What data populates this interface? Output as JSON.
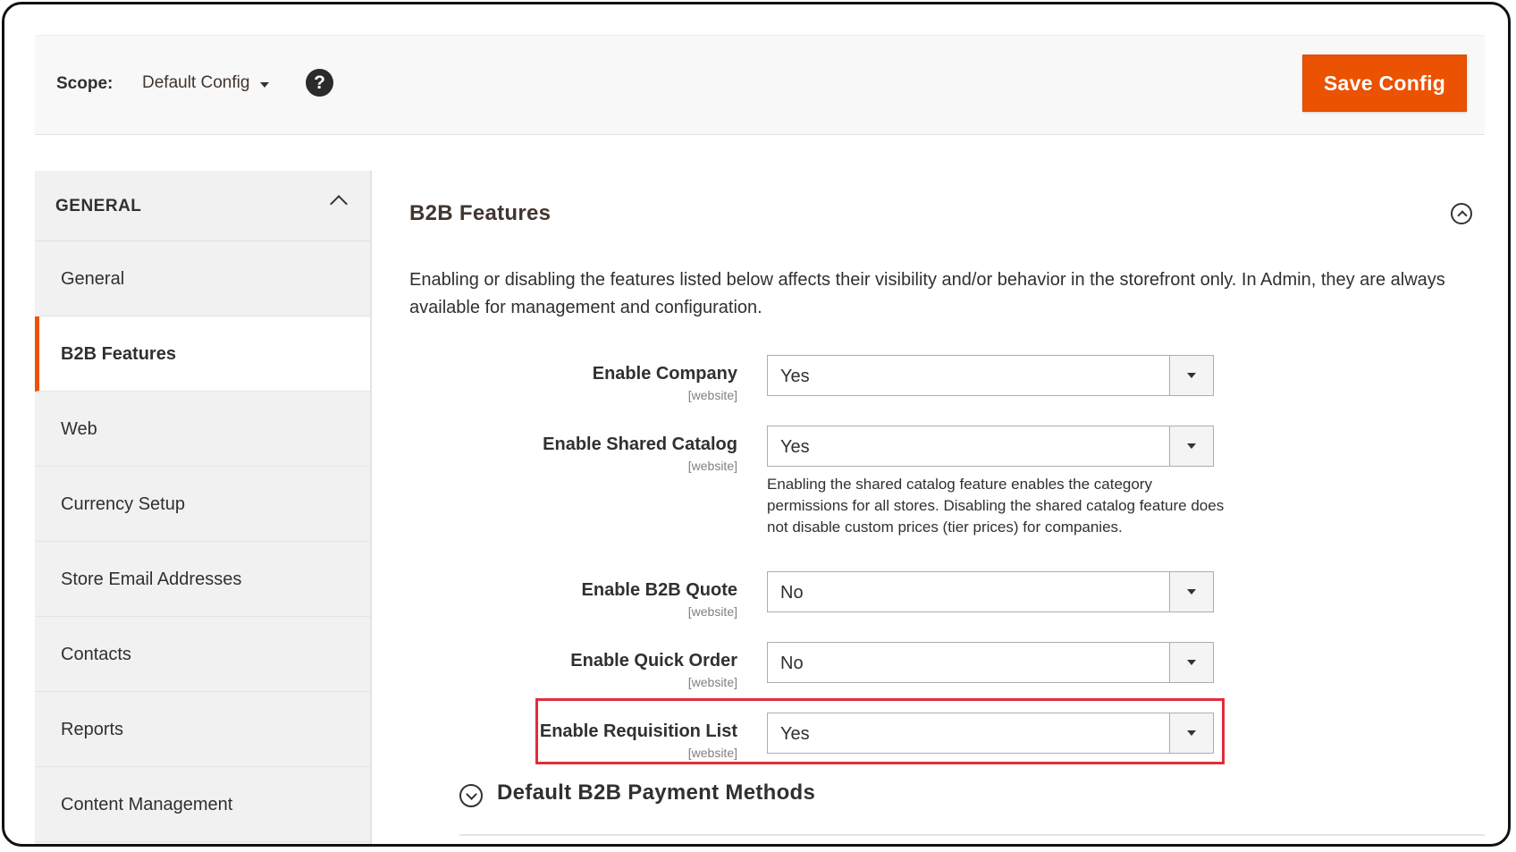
{
  "header": {
    "scope_label": "Scope:",
    "scope_value": "Default Config",
    "help_icon": "?",
    "save_label": "Save Config"
  },
  "sidebar": {
    "title": "GENERAL",
    "items": [
      {
        "label": "General",
        "active": false
      },
      {
        "label": "B2B Features",
        "active": true
      },
      {
        "label": "Web",
        "active": false
      },
      {
        "label": "Currency Setup",
        "active": false
      },
      {
        "label": "Store Email Addresses",
        "active": false
      },
      {
        "label": "Contacts",
        "active": false
      },
      {
        "label": "Reports",
        "active": false
      },
      {
        "label": "Content Management",
        "active": false
      }
    ]
  },
  "main": {
    "section_title": "B2B Features",
    "description": "Enabling or disabling the features listed below affects their visibility and/or behavior in the storefront only. In Admin, they are always available for management and configuration.",
    "fields": [
      {
        "label": "Enable Company",
        "scope": "[website]",
        "value": "Yes"
      },
      {
        "label": "Enable Shared Catalog",
        "scope": "[website]",
        "value": "Yes"
      },
      {
        "label": "Enable B2B Quote",
        "scope": "[website]",
        "value": "No"
      },
      {
        "label": "Enable Quick Order",
        "scope": "[website]",
        "value": "No"
      },
      {
        "label": "Enable Requisition List",
        "scope": "[website]",
        "value": "Yes"
      }
    ],
    "shared_catalog_hint": "Enabling the shared catalog feature enables the category permissions for all stores. Disabling the shared catalog feature does not disable custom prices (tier prices) for companies.",
    "sub_section_title": "Default B2B Payment Methods"
  },
  "colors": {
    "accent": "#eb5202",
    "highlight": "#e12d3a"
  }
}
